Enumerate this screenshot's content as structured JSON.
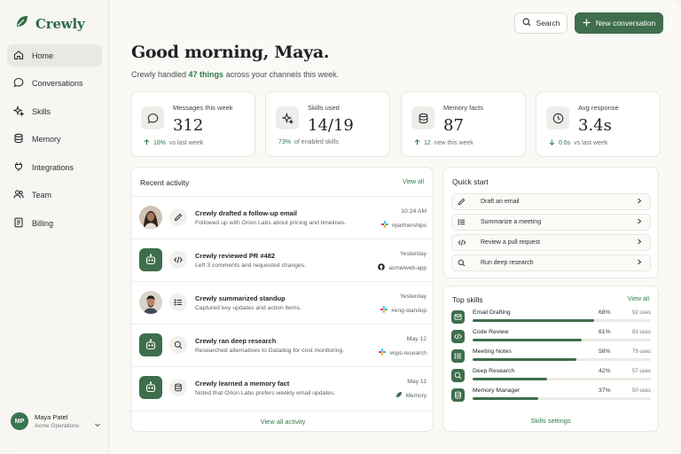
{
  "brand": {
    "name": "Crewly",
    "accent": "#3e6e4b"
  },
  "sidebar": {
    "items": [
      {
        "label": "Home",
        "icon": "home-icon"
      },
      {
        "label": "Conversations",
        "icon": "chat-icon"
      },
      {
        "label": "Skills",
        "icon": "sparkle-icon"
      },
      {
        "label": "Memory",
        "icon": "database-icon"
      },
      {
        "label": "Integrations",
        "icon": "plug-icon"
      },
      {
        "label": "Team",
        "icon": "team-icon"
      },
      {
        "label": "Billing",
        "icon": "receipt-icon"
      }
    ],
    "user": {
      "initials": "MP",
      "name": "Maya Patel",
      "org": "Acme Operations"
    }
  },
  "header": {
    "search_label": "Search",
    "new_label": "New conversation",
    "greeting": "Good morning, Maya.",
    "sub_prefix": "Crewly handled ",
    "sub_highlight": "47 things",
    "sub_suffix": " across your channels this week."
  },
  "stats": [
    {
      "label": "Messages this week",
      "value": "312",
      "foot_value": "18%",
      "foot_text": "vs last week",
      "trend": "up",
      "icon": "chat-icon"
    },
    {
      "label": "Skills used",
      "value": "14/19",
      "foot_value": "73%",
      "foot_text": "of enabled skills",
      "trend": "none",
      "icon": "sparkle-icon"
    },
    {
      "label": "Memory facts",
      "value": "87",
      "foot_value": "12",
      "foot_text": "new this week",
      "trend": "up",
      "icon": "database-icon"
    },
    {
      "label": "Avg response",
      "value": "3.4s",
      "foot_value": "0.6s",
      "foot_text": "vs last week",
      "trend": "down",
      "icon": "clock-icon"
    }
  ],
  "activity": {
    "title": "Recent activity",
    "view_all": "View all",
    "footer": "View all activity",
    "items": [
      {
        "title": "Crewly drafted a follow-up email",
        "desc": "Followed up with Orion Labs about pricing and timelines.",
        "time": "10:24 AM",
        "source": "#partnerships",
        "actor": "person",
        "action_icon": "pencil-icon",
        "source_icon": "slack-icon"
      },
      {
        "title": "Crewly reviewed PR #482",
        "desc": "Left 3 comments and requested changes.",
        "time": "Yesterday",
        "source": "acme/web-app",
        "actor": "bot",
        "action_icon": "code-icon",
        "source_icon": "github-icon"
      },
      {
        "title": "Crewly summarized standup",
        "desc": "Captured key updates and action items.",
        "time": "Yesterday",
        "source": "#eng-standup",
        "actor": "person",
        "action_icon": "list-icon",
        "source_icon": "slack-icon"
      },
      {
        "title": "Crewly ran deep research",
        "desc": "Researched alternatives to Datadog for cost monitoring.",
        "time": "May 12",
        "source": "#ops-research",
        "actor": "bot",
        "action_icon": "search-icon",
        "source_icon": "slack-icon"
      },
      {
        "title": "Crewly learned a memory fact",
        "desc": "Noted that Orion Labs prefers weekly email updates.",
        "time": "May 11",
        "source": "Memory",
        "actor": "bot",
        "action_icon": "database-icon",
        "source_icon": "leaf-icon"
      }
    ]
  },
  "quick_start": {
    "title": "Quick start",
    "items": [
      {
        "label": "Draft an email",
        "icon": "pencil-icon"
      },
      {
        "label": "Summarize a meeting",
        "icon": "list-icon"
      },
      {
        "label": "Review a pull request",
        "icon": "code-icon"
      },
      {
        "label": "Run deep research",
        "icon": "search-icon"
      }
    ]
  },
  "top_skills": {
    "title": "Top skills",
    "view_all": "View all",
    "settings": "Skills settings",
    "items": [
      {
        "name": "Email Drafting",
        "pct": "68%",
        "fraction": 0.68,
        "uses": "92 uses",
        "icon": "mail-icon"
      },
      {
        "name": "Code Review",
        "pct": "61%",
        "fraction": 0.61,
        "uses": "83 uses",
        "icon": "code-icon"
      },
      {
        "name": "Meeting Notes",
        "pct": "58%",
        "fraction": 0.58,
        "uses": "79 uses",
        "icon": "list-icon"
      },
      {
        "name": "Deep Research",
        "pct": "42%",
        "fraction": 0.42,
        "uses": "57 uses",
        "icon": "search-icon"
      },
      {
        "name": "Memory Manager",
        "pct": "37%",
        "fraction": 0.37,
        "uses": "50 uses",
        "icon": "database-icon"
      }
    ]
  }
}
